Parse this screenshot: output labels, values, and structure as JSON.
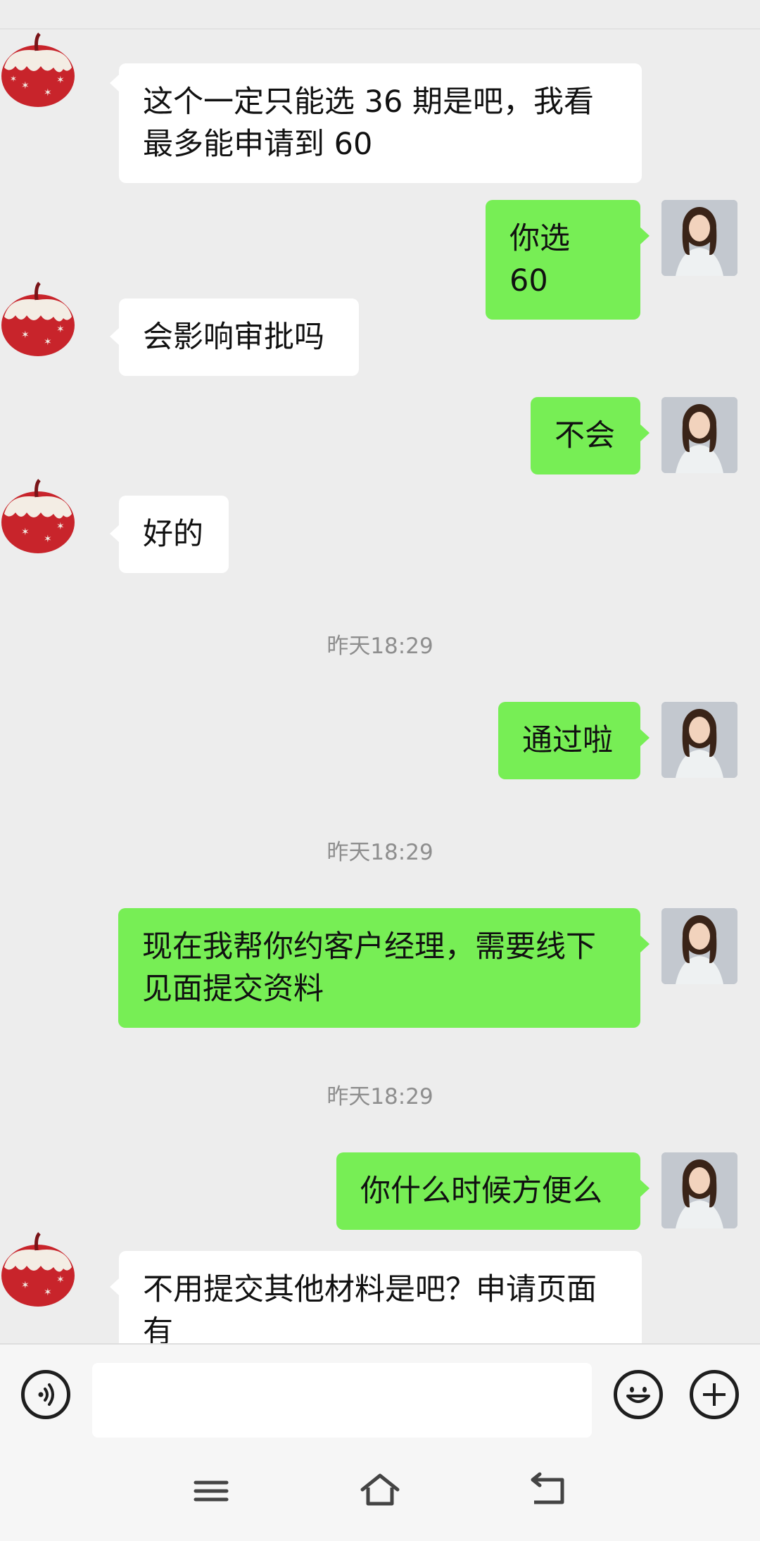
{
  "messages": [
    {
      "from": "contact",
      "text": "这个一定只能选 36 期是吧，我看\n最多能申请到 60"
    },
    {
      "from": "me",
      "text": "你选 60"
    },
    {
      "from": "contact",
      "text": "会影响审批吗"
    },
    {
      "from": "me",
      "text": "不会"
    },
    {
      "from": "contact",
      "text": "好的"
    },
    {
      "timestamp": "昨天18:29"
    },
    {
      "from": "me",
      "text": "通过啦"
    },
    {
      "timestamp": "昨天18:29"
    },
    {
      "from": "me",
      "text": "现在我帮你约客户经理，需要线下\n见面提交资料"
    },
    {
      "timestamp": "昨天18:29"
    },
    {
      "from": "me",
      "text": "你什么时候方便么"
    },
    {
      "from": "contact",
      "text": "不用提交其他材料是吧？申请页面\n有"
    }
  ],
  "input_bar": {
    "voice_icon": "voice-icon",
    "emoji_icon": "emoji-icon",
    "more_icon": "plus-circle-icon",
    "input_value": ""
  },
  "nav_bar": {
    "menu_icon": "menu-icon",
    "home_icon": "home-icon",
    "back_icon": "back-icon"
  },
  "colors": {
    "background": "#ededed",
    "outgoing_bubble": "#77ee55",
    "incoming_bubble": "#ffffff",
    "timestamp_text": "#8e8e8e"
  }
}
